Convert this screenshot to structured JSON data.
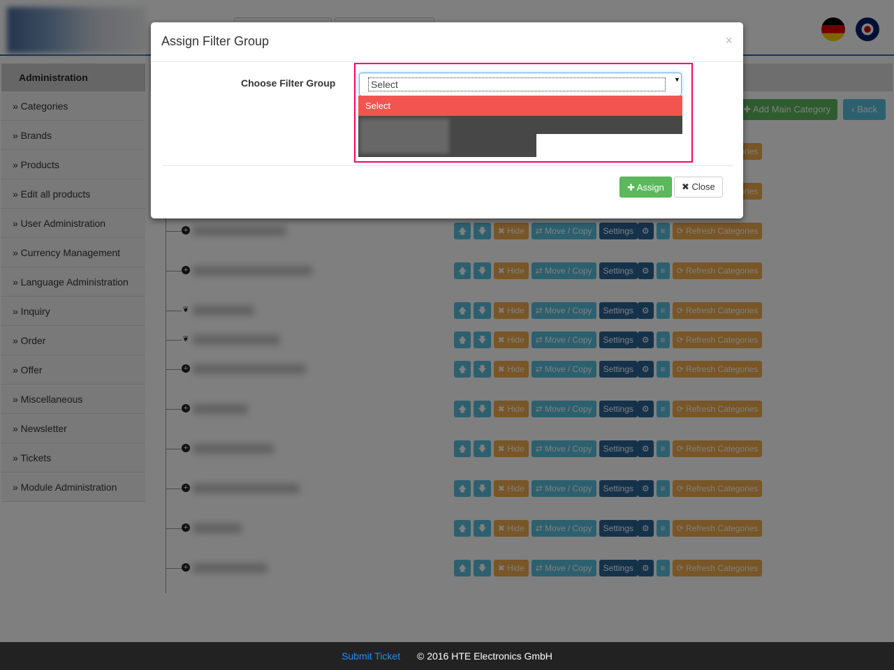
{
  "sidebar": {
    "header": "Administration",
    "items": [
      "» Categories",
      "» Brands",
      "» Products",
      "» Edit all products",
      "» User Administration",
      "» Currency Management",
      "» Language Administration",
      "» Inquiry",
      "» Order",
      "» Offer",
      "» Miscellaneous",
      "» Newsletter",
      "» Tickets",
      "» Module Administration"
    ]
  },
  "toolbar": {
    "add_main_category": "✚ Add Main Category",
    "back": "‹ Back"
  },
  "row_buttons": {
    "up": "🡅",
    "down": "🡇",
    "hide": "✖ Hide",
    "move_copy": "⇄ Move / Copy",
    "settings": "Settings",
    "gear": "⚙",
    "list": "≡",
    "refresh": "⟳ Refresh Categories"
  },
  "rows": [
    {
      "icon": "plus"
    },
    {
      "icon": "plus"
    },
    {
      "icon": "leaf"
    },
    {
      "icon": "leaf"
    },
    {
      "icon": "plus"
    },
    {
      "icon": "plus"
    },
    {
      "icon": "plus"
    },
    {
      "icon": "plus"
    },
    {
      "icon": "plus"
    },
    {
      "icon": "plus"
    }
  ],
  "modal": {
    "title": "Assign Filter Group",
    "close": "×",
    "label": "Choose Filter Group",
    "select_value": "Select",
    "options": [
      "Select"
    ],
    "assign": "✚ Assign",
    "close_button": "✖ Close",
    "highlight_color": "#ff0066",
    "option_selected_color": "#f2554f"
  },
  "footer": {
    "submit_ticket": "Submit Ticket",
    "copyright": "© 2016 HTE Electronics GmbH"
  }
}
